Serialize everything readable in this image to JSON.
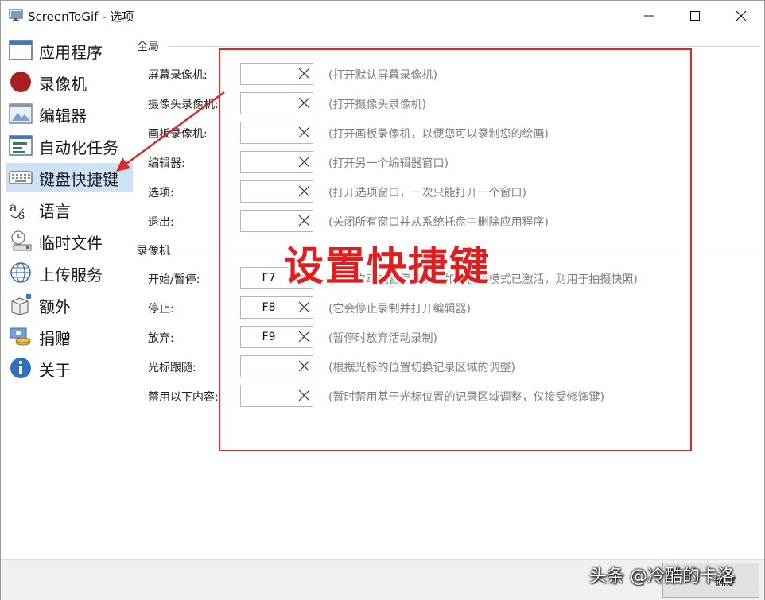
{
  "window": {
    "title": "ScreenToGif - 选项"
  },
  "sidebar": {
    "items": [
      {
        "label": "应用程序",
        "icon": "application-window-icon"
      },
      {
        "label": "录像机",
        "icon": "recorder-icon"
      },
      {
        "label": "编辑器",
        "icon": "editor-icon"
      },
      {
        "label": "自动化任务",
        "icon": "automation-icon"
      },
      {
        "label": "键盘快捷键",
        "icon": "keyboard-icon",
        "selected": true
      },
      {
        "label": "语言",
        "icon": "language-icon"
      },
      {
        "label": "临时文件",
        "icon": "temp-files-icon"
      },
      {
        "label": "上传服务",
        "icon": "globe-icon"
      },
      {
        "label": "额外",
        "icon": "extras-icon"
      },
      {
        "label": "捐赠",
        "icon": "donate-icon"
      },
      {
        "label": "关于",
        "icon": "info-icon"
      }
    ]
  },
  "sections": {
    "global": "全局",
    "recorder": "录像机"
  },
  "shortcuts": {
    "global": [
      {
        "label": "屏幕录像机:",
        "key": "",
        "desc": "(打开默认屏幕录像机)"
      },
      {
        "label": "摄像头录像机:",
        "key": "",
        "desc": "(打开摄像头录像机)"
      },
      {
        "label": "画板录像机:",
        "key": "",
        "desc": "(打开画板录像机，以便您可以录制您的绘画)"
      },
      {
        "label": "编辑器:",
        "key": "",
        "desc": "(打开另一个编辑器窗口)"
      },
      {
        "label": "选项:",
        "key": "",
        "desc": "(打开选项窗口，一次只能打开一个窗口)"
      },
      {
        "label": "退出:",
        "key": "",
        "desc": "(关闭所有窗口并从系统托盘中删除应用程序)"
      }
    ],
    "recorder": [
      {
        "label": "开始/暂停:",
        "key": "F7",
        "desc": "(它会启动或暂停录制。如果快照模式已激活，则用于拍摄快照)"
      },
      {
        "label": "停止:",
        "key": "F8",
        "desc": "(它会停止录制并打开编辑器)"
      },
      {
        "label": "放弃:",
        "key": "F9",
        "desc": "(暂停时放弃活动录制)"
      },
      {
        "label": "光标跟随:",
        "key": "",
        "desc": "(根据光标的位置切换记录区域的调整)"
      },
      {
        "label": "禁用以下内容:",
        "key": "",
        "desc": "(暂时禁用基于光标位置的记录区域调整，仅接受修饰键)"
      }
    ]
  },
  "annotation": {
    "text": "设置快捷键",
    "color": "#e21d1d"
  },
  "footer": {
    "ok_label": "确定",
    "watermark": "头条 @冷酷的卡洛"
  },
  "colors": {
    "selection": "#cde3f5",
    "highlight_border": "#d22e2e"
  }
}
